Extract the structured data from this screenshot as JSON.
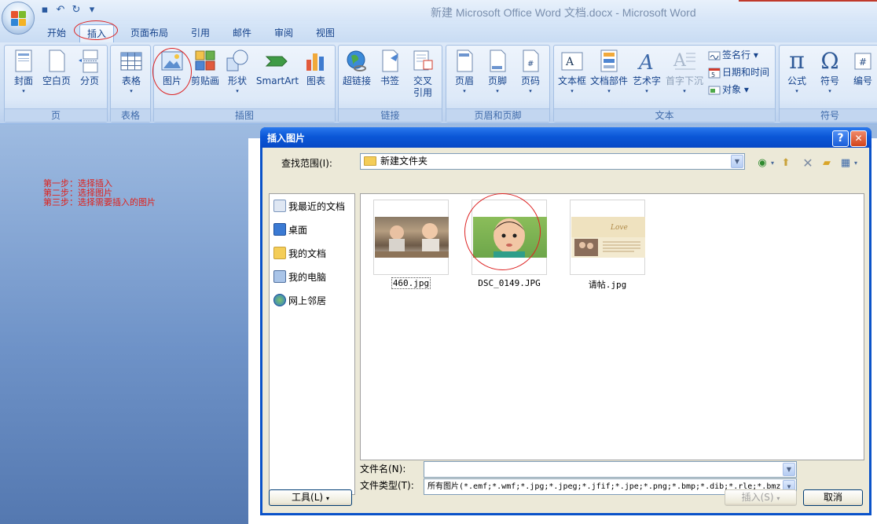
{
  "window": {
    "title": "新建 Microsoft Office Word 文档.docx - Microsoft Word"
  },
  "qat": {
    "save_icon": "save-icon",
    "undo_icon": "undo-icon",
    "redo_icon": "redo-icon",
    "customize": "▾"
  },
  "tabs": [
    {
      "label": "开始"
    },
    {
      "label": "插入"
    },
    {
      "label": "页面布局"
    },
    {
      "label": "引用"
    },
    {
      "label": "邮件"
    },
    {
      "label": "审阅"
    },
    {
      "label": "视图"
    }
  ],
  "ribbon": {
    "groups": {
      "page": "页",
      "table": "表格",
      "illustrations": "插图",
      "links": "链接",
      "header_footer": "页眉和页脚",
      "text": "文本",
      "symbols": "符号"
    },
    "buttons": {
      "cover": "封面",
      "blank_page": "空白页",
      "page_break": "分页",
      "table": "表格",
      "picture": "图片",
      "clipart": "剪贴画",
      "shapes": "形状",
      "smartart": "SmartArt",
      "chart": "图表",
      "hyperlink": "超链接",
      "bookmark": "书签",
      "cross_ref_1": "交叉",
      "cross_ref_2": "引用",
      "header": "页眉",
      "footer": "页脚",
      "page_number": "页码",
      "textbox": "文本框",
      "quickparts": "文档部件",
      "wordart": "艺术字",
      "dropcap": "首字下沉",
      "signature": "签名行",
      "datetime": "日期和时间",
      "object": "对象",
      "equation": "公式",
      "symbol": "符号",
      "numbering": "编号"
    }
  },
  "steps": [
    "第一步：选择插入",
    "第二步：选择图片",
    "第三步：选择需要插入的图片"
  ],
  "dialog": {
    "title": "插入图片",
    "help": "?",
    "close": "✕",
    "look_in_label": "查找范围(I):",
    "look_in_value": "新建文件夹",
    "places": [
      {
        "label": "我最近的文档"
      },
      {
        "label": "桌面"
      },
      {
        "label": "我的文档"
      },
      {
        "label": "我的电脑"
      },
      {
        "label": "网上邻居"
      }
    ],
    "files": [
      {
        "name": "460.jpg"
      },
      {
        "name": "DSC_0149.JPG"
      },
      {
        "name": "请帖.jpg"
      }
    ],
    "filename_label": "文件名(N):",
    "filename_value": "",
    "filetype_label": "文件类型(T):",
    "filetype_value": "所有图片(*.emf;*.wmf;*.jpg;*.jpeg;*.jfif;*.jpe;*.png;*.bmp;*.dib;*.rle;*.bmz",
    "tools_button": "工具(L)",
    "insert_button": "插入(S)",
    "cancel_button": "取消"
  }
}
